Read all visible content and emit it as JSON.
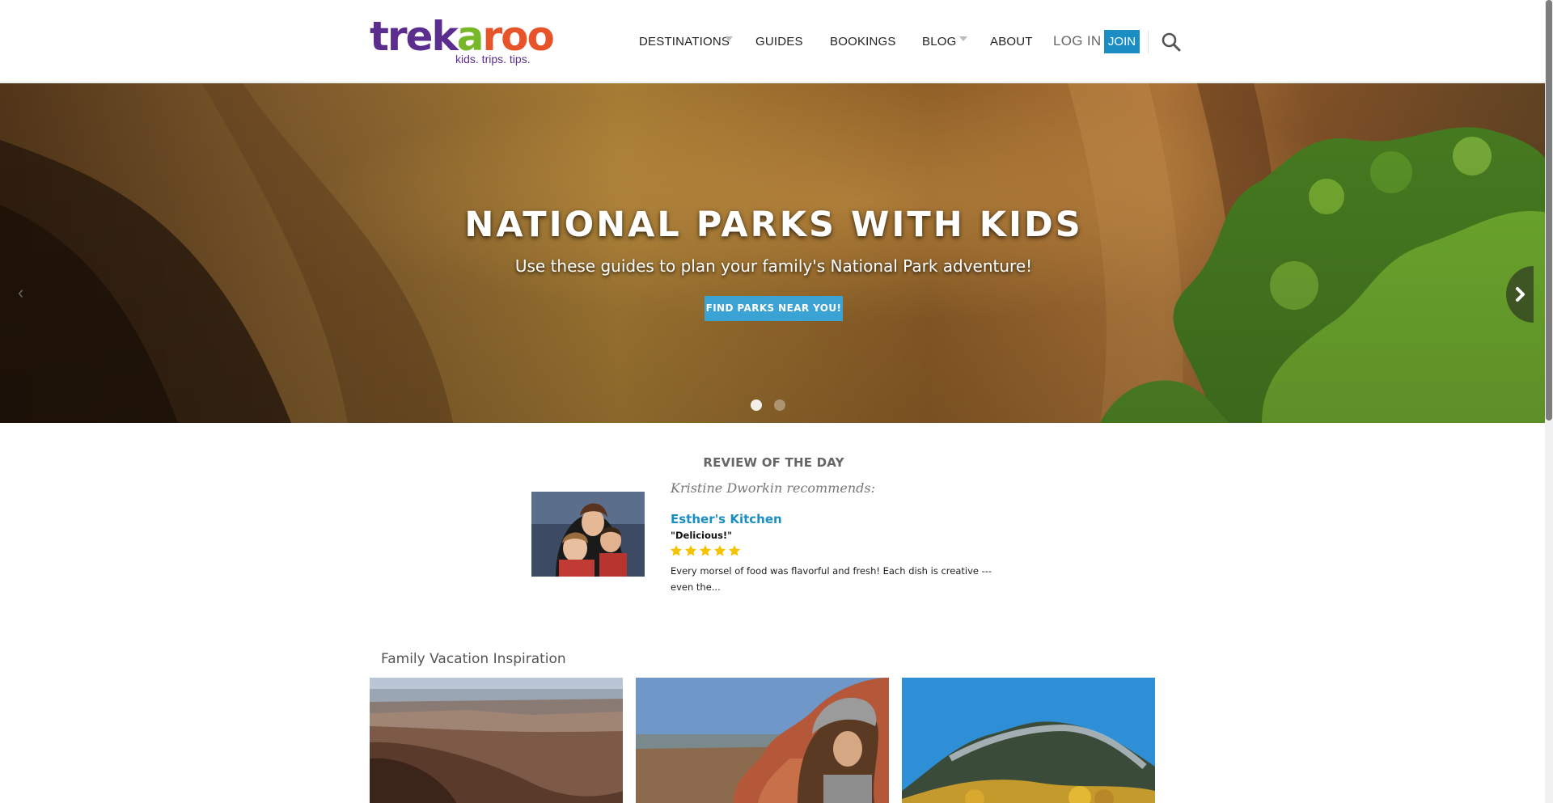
{
  "logo": {
    "word_parts": [
      "trek",
      "a",
      "r",
      "o",
      "o"
    ],
    "tagline": "kids. trips. tips."
  },
  "nav": {
    "destinations": "DESTINATIONS",
    "guides": "GUIDES",
    "bookings": "BOOKINGS",
    "blog": "BLOG",
    "about": "ABOUT",
    "login": "LOG IN",
    "join": "JOIN"
  },
  "hero": {
    "title": "NATIONAL PARKS WITH KIDS",
    "subtitle": "Use these guides to plan your family's National Park adventure!",
    "button": "FIND PARKS NEAR YOU!",
    "slide_count": 2,
    "active_slide": 1
  },
  "review": {
    "heading": "REVIEW OF THE DAY",
    "recommender": "Kristine Dworkin recommends:",
    "place": "Esther's Kitchen",
    "quote": "\"Delicious!\"",
    "rating": 5,
    "excerpt": "Every morsel of food was flavorful and fresh!  Each dish is creative --- even the..."
  },
  "inspiration": {
    "heading": "Family Vacation Inspiration"
  },
  "colors": {
    "brand_purple": "#5b2d8e",
    "brand_green": "#77b82a",
    "brand_orange": "#e8542a",
    "accent_blue": "#1a8ec3",
    "button_blue": "#3ba2d4",
    "star_yellow": "#f5c400"
  },
  "icons": {
    "search": "search-icon",
    "next": "chevron-right-icon",
    "prev": "chevron-left-icon",
    "star": "star-icon"
  }
}
